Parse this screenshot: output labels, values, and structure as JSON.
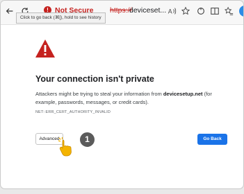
{
  "browser": {
    "security_label": "Not Secure",
    "url_scheme": "https://",
    "url_host": "deviceset...",
    "tooltip": "Click to go back (⌘[), hold to see history",
    "toolbar_icons": [
      "back-arrow-icon",
      "reload-icon",
      "read-aloud-icon",
      "favorite-star-icon",
      "refresh-icon",
      "split-screen-icon",
      "favorites-icon",
      "collections-icon",
      "copilot-icon",
      "profile-icon"
    ]
  },
  "page": {
    "title": "Your connection isn't private",
    "desc_prefix": "Attackers might be trying to steal your information from ",
    "desc_domain": "devicesetup.net",
    "desc_suffix": " (for example, passwords, messages, or credit cards).",
    "error_code": "NET::ERR_CERT_AUTHORITY_INVALID",
    "advanced_label": "Advanced",
    "go_back_label": "Go Back"
  },
  "annotation": {
    "step_number": "1"
  },
  "colors": {
    "danger": "#c5221f",
    "primary": "#1a73e8",
    "badge": "#5b5b5b",
    "hand": "#f4b400"
  }
}
